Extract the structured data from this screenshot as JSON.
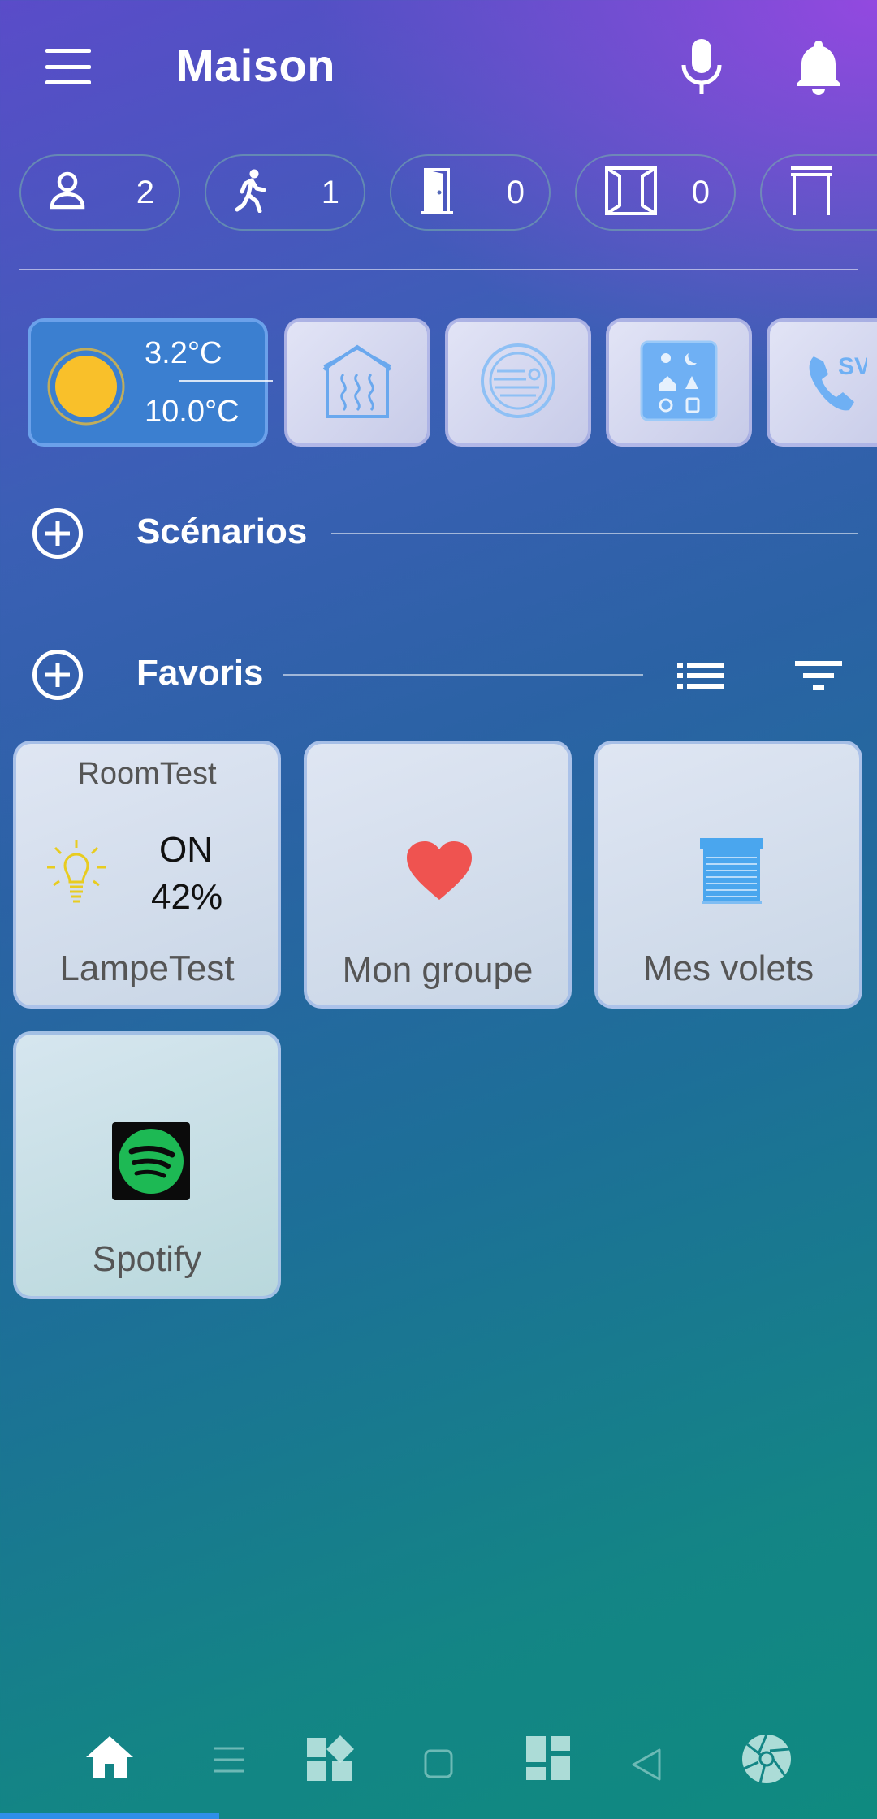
{
  "header": {
    "title": "Maison",
    "menu_icon": "hamburger-menu-icon",
    "mic_icon": "microphone-icon",
    "bell_icon": "bell-icon"
  },
  "status_chips": [
    {
      "icon": "person-icon",
      "count": "2"
    },
    {
      "icon": "walking-person-icon",
      "count": "1"
    },
    {
      "icon": "door-icon",
      "count": "0"
    },
    {
      "icon": "window-icon",
      "count": "0"
    },
    {
      "icon": "shutter-icon",
      "count": ""
    }
  ],
  "weather": {
    "temp_min": "3.2°C",
    "temp_max": "10.0°C",
    "icon": "sun-icon"
  },
  "quick_tiles": [
    {
      "icon": "heating-house-icon"
    },
    {
      "icon": "air-conditioner-icon"
    },
    {
      "icon": "mode-panel-icon"
    },
    {
      "icon": "phone-icon"
    }
  ],
  "sections": {
    "scenarios": "Scénarios",
    "favoris": "Favoris"
  },
  "favorites": [
    {
      "room": "RoomTest",
      "state": "ON",
      "level": "42%",
      "label": "LampeTest",
      "icon": "lightbulb-icon"
    },
    {
      "label": "Mon groupe",
      "icon": "heart-icon"
    },
    {
      "label": "Mes volets",
      "icon": "shutter-icon"
    },
    {
      "label": "Spotify",
      "icon": "spotify-icon"
    }
  ],
  "nav": {
    "items": [
      "home-icon",
      "menu-lines-icon",
      "apps-icon",
      "square-icon",
      "dashboard-icon",
      "back-triangle-icon",
      "aperture-icon"
    ]
  },
  "colors": {
    "weather_tile": "#3b7fd0",
    "sun": "#f9c02a",
    "heart": "#ef5350",
    "shutter": "#4aa6ee",
    "spotify": "#1db954",
    "bulb": "#e8cc20",
    "nav_indicator": "#2f8fe8"
  }
}
